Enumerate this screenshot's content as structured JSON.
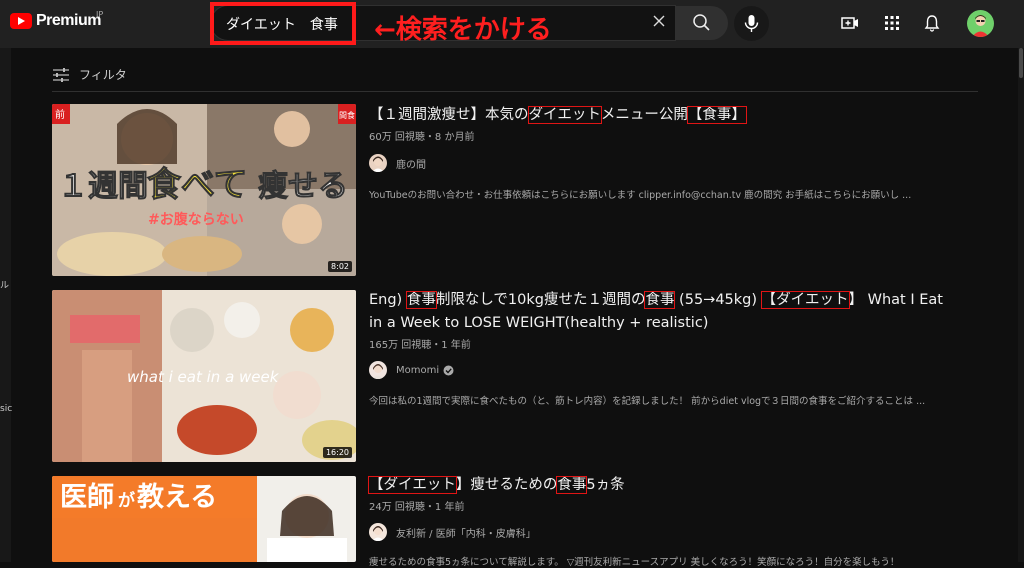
{
  "header": {
    "logo_text": "Premium",
    "logo_region": "JP",
    "search_value": "ダイエット　食事",
    "annotation": "←検索をかける"
  },
  "left_rail": {
    "labels": [
      "ル",
      "sic"
    ]
  },
  "filter": {
    "label": "フィルタ"
  },
  "videos": [
    {
      "title_parts": [
        "【１週間激痩せ】本気の",
        "ダイエット",
        "メニュー公開",
        "【食事】"
      ],
      "views": "60万 回視聴・8 か月前",
      "channel": "鹿の間",
      "description": "YouTubeのお問い合わせ・お仕事依頼はこちらにお願いします clipper.info@cchan.tv 鹿の間究 お手紙はこちらにお願いし ...",
      "duration": "8:02",
      "thumb_text": [
        "１週間",
        "食べて",
        "痩せる",
        "#お腹ならない"
      ],
      "thumb_corner_left": [
        "前"
      ],
      "thumb_corner_right": "間食"
    },
    {
      "title_line1_parts": [
        "Eng) ",
        "食事",
        "制限なしで10kg痩せた１週間の",
        "食事",
        " (55→45kg) ",
        "【ダイエット",
        "】 What I Eat"
      ],
      "title_line2": "in a Week to LOSE WEIGHT(healthy + realistic)",
      "views": "165万 回視聴・1 年前",
      "channel": "Momomi",
      "description": "今回は私の1週間で実際に食べたもの（と、筋トレ内容）を記録しました！ 前からdiet vlogで３日間の食事をご紹介することは ...",
      "duration": "16:20",
      "thumb_text": "what i eat in a week"
    },
    {
      "title_parts": [
        "【ダイエット",
        "】痩せるための",
        "食事",
        "5ヵ条"
      ],
      "views": "24万 回視聴・1 年前",
      "channel": "友利新 / 医師「内科・皮膚科」",
      "description": "痩せるための食事5ヵ条について解説します。 ▽週刊友利新ニュースアプリ 美しくなろう！笑顔になろう！自分を楽しもう！",
      "thumb_text": [
        "医師",
        "が",
        "教える"
      ]
    }
  ],
  "colors": {
    "background": "#0f0f0f",
    "header": "#212121",
    "accent_red": "#ff1a1a",
    "text_primary": "#f1f1f1",
    "text_secondary": "#aaaaaa"
  }
}
